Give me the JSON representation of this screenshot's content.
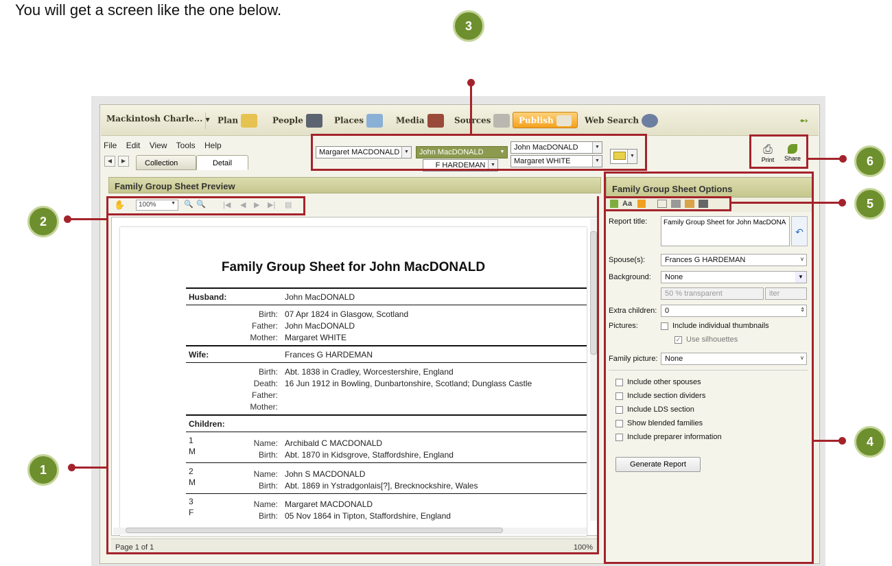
{
  "intro": "You will get a screen like the one below.",
  "callouts": [
    "1",
    "2",
    "3",
    "4",
    "5",
    "6"
  ],
  "nav": {
    "tree": "Mackintosh Charle...",
    "plan": "Plan",
    "people": "People",
    "places": "Places",
    "media": "Media",
    "sources": "Sources",
    "publish": "Publish",
    "websearch": "Web Search"
  },
  "menu": [
    "File",
    "Edit",
    "View",
    "Tools",
    "Help"
  ],
  "tabs": {
    "collection": "Collection",
    "detail": "Detail"
  },
  "family_nav": {
    "father": "Margaret MACDONALD",
    "selected": "John MacDONALD",
    "spouse": "F HARDEMAN",
    "parent1": "John MacDONALD",
    "parent2": "Margaret WHITE"
  },
  "actions": {
    "print": "Print",
    "share": "Share"
  },
  "preview": {
    "title": "Family Group Sheet Preview",
    "zoom": "100%",
    "status_page": "Page 1 of 1",
    "status_zoom": "100%",
    "report_title": "Family Group Sheet for John MacDONALD",
    "husband_label": "Husband:",
    "husband": "John MacDONALD",
    "h_birth_l": "Birth:",
    "h_birth": "07 Apr 1824 in Glasgow, Scotland",
    "h_father_l": "Father:",
    "h_father": "John MacDONALD",
    "h_mother_l": "Mother:",
    "h_mother": "Margaret WHITE",
    "wife_label": "Wife:",
    "wife": "Frances G HARDEMAN",
    "w_birth_l": "Birth:",
    "w_birth": "Abt. 1838 in Cradley, Worcestershire, England",
    "w_death_l": "Death:",
    "w_death": "16 Jun 1912 in Bowling, Dunbartonshire, Scotland; Dunglass Castle",
    "w_father_l": "Father:",
    "w_mother_l": "Mother:",
    "children_label": "Children:",
    "c1_num": "1",
    "c1_sex": "M",
    "c1_name_l": "Name:",
    "c1_name": "Archibald C MACDONALD",
    "c1_birth_l": "Birth:",
    "c1_birth": "Abt. 1870 in Kidsgrove, Staffordshire, England",
    "c2_num": "2",
    "c2_sex": "M",
    "c2_name_l": "Name:",
    "c2_name": "John S MACDONALD",
    "c2_birth_l": "Birth:",
    "c2_birth": "Abt. 1869 in Ystradgonlais[?], Brecknockshire, Wales",
    "c3_num": "3",
    "c3_sex": "F",
    "c3_name_l": "Name:",
    "c3_name": "Margaret MACDONALD",
    "c3_birth_l": "Birth:",
    "c3_birth": "05 Nov 1864 in Tipton, Staffordshire, England"
  },
  "options": {
    "title": "Family Group Sheet Options",
    "report_title_l": "Report title:",
    "report_title_v": "Family Group Sheet for John MacDONA",
    "spouses_l": "Spouse(s):",
    "spouses_v": "Frances G HARDEMAN",
    "background_l": "Background:",
    "background_v": "None",
    "transp_v": "50",
    "transp_t": "% transparent",
    "filter_t": "iter",
    "extra_l": "Extra children:",
    "extra_v": "0",
    "pictures_l": "Pictures:",
    "thumbs": "Include individual thumbnails",
    "silhouettes": "Use silhouettes",
    "family_pic_l": "Family picture:",
    "family_pic_v": "None",
    "other_spouses": "Include other spouses",
    "section_dividers": "Include section dividers",
    "lds": "Include LDS section",
    "blended": "Show blended families",
    "preparer": "Include preparer information",
    "generate": "Generate Report"
  }
}
